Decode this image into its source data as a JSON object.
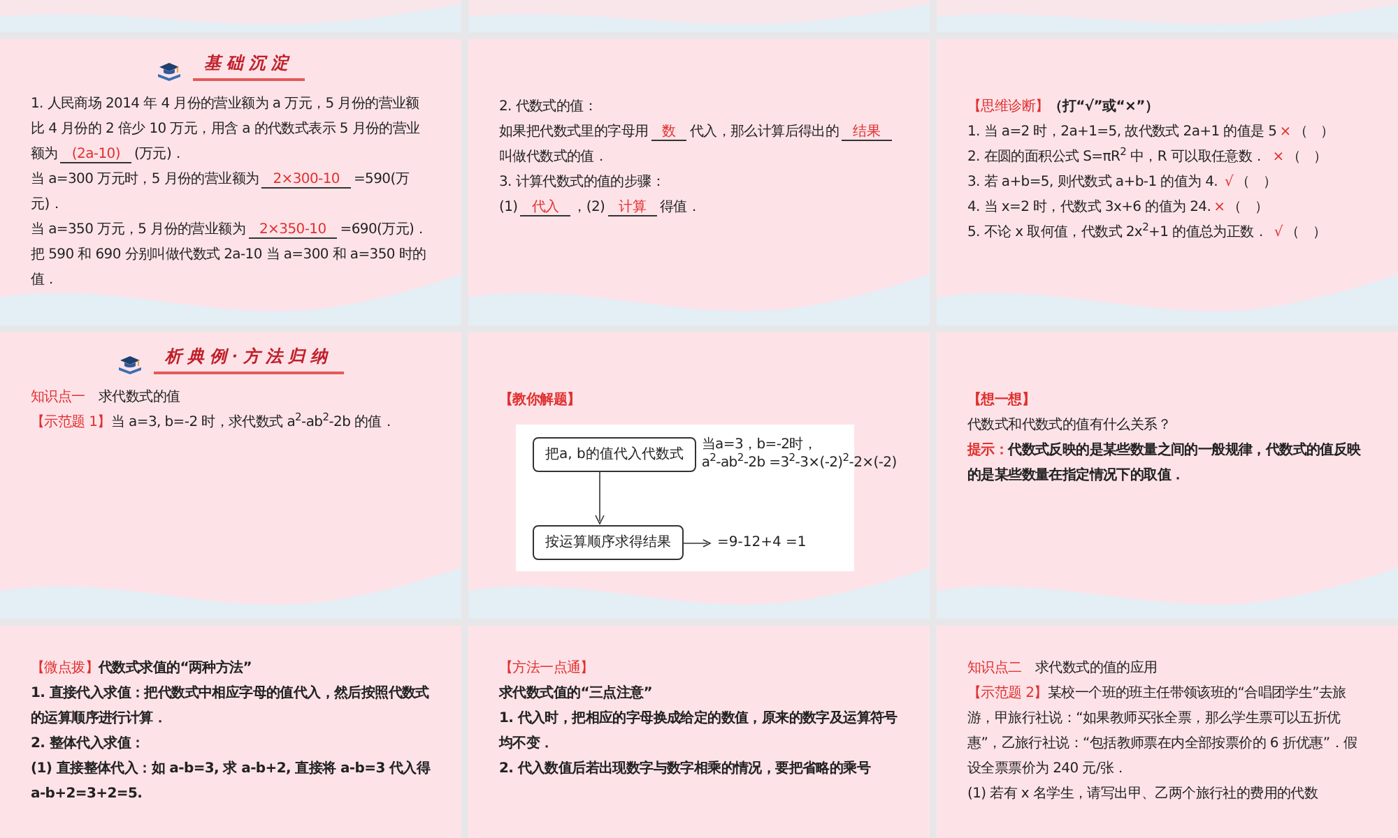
{
  "slides": [
    {
      "header": {
        "title": "基础沉淀"
      },
      "paragraphs": [
        [
          {
            "kind": "text",
            "text": "1. 人民商场 2014 年 4 月份的营业额为 a 万元，5 月份的营业额比 4 月份的 2 倍少 10 万元，用含 a 的代数式表示 5 月份的营业额为"
          },
          {
            "kind": "answer",
            "text": "(2a-10)"
          },
          {
            "kind": "text",
            "text": "(万元)．"
          }
        ],
        [
          {
            "kind": "text",
            "text": "当 a=300 万元时，5 月份的营业额为"
          },
          {
            "kind": "answer",
            "text": "2×300-10"
          },
          {
            "kind": "text",
            "text": "=590(万元)．"
          }
        ],
        [
          {
            "kind": "text",
            "text": "当 a=350 万元，5 月份的营业额为"
          },
          {
            "kind": "answer",
            "text": "2×350-10"
          },
          {
            "kind": "text",
            "text": "=690(万元)．"
          }
        ],
        [
          {
            "kind": "text",
            "text": "把 590 和 690 分别叫做代数式 2a-10 当 a=300 和 a=350 时的值．"
          }
        ]
      ]
    },
    {
      "paragraphs": [
        [
          {
            "kind": "text",
            "text": "2. 代数式的值："
          }
        ],
        [
          {
            "kind": "text",
            "text": "如果把代数式里的字母用"
          },
          {
            "kind": "answer",
            "text": "数"
          },
          {
            "kind": "text",
            "text": "代入，那么计算后得出的"
          },
          {
            "kind": "answer",
            "text": "结果"
          },
          {
            "kind": "text",
            "text": "叫做代数式的值．"
          }
        ],
        [
          {
            "kind": "text",
            "text": "3. 计算代数式的值的步骤："
          }
        ],
        [
          {
            "kind": "text",
            "text": "(1)"
          },
          {
            "kind": "answer",
            "text": "代入"
          },
          {
            "kind": "text",
            "text": "，(2)"
          },
          {
            "kind": "answer",
            "text": "计算"
          },
          {
            "kind": "text",
            "text": "得值．"
          }
        ]
      ]
    },
    {
      "paragraphs": [
        [
          {
            "kind": "label",
            "text": "【思维诊断】"
          },
          {
            "kind": "strong",
            "text": "（打“√”或“×”）"
          }
        ],
        [
          {
            "kind": "text",
            "text": "1. 当 a=2 时，2a+1=5, 故代数式 2a+1 的值是 5"
          },
          {
            "kind": "mark",
            "text": "×"
          },
          {
            "kind": "text",
            "text": "（　）"
          }
        ],
        [
          {
            "kind": "text",
            "text": "2. 在圆的面积公式 S=πR$^{2}$ 中，R 可以取任意数． "
          },
          {
            "kind": "mark",
            "text": "×"
          },
          {
            "kind": "text",
            "text": "（　）"
          }
        ],
        [
          {
            "kind": "text",
            "text": "3. 若 a+b=5, 则代数式 a+b-1 的值为 4. "
          },
          {
            "kind": "mark",
            "text": "√"
          },
          {
            "kind": "text",
            "text": "（　）"
          }
        ],
        [
          {
            "kind": "text",
            "text": "4. 当 x=2 时，代数式 3x+6 的值为 24."
          },
          {
            "kind": "mark",
            "text": "×"
          },
          {
            "kind": "text",
            "text": "（　）"
          }
        ],
        [
          {
            "kind": "text",
            "text": "5. 不论 x 取何值，代数式 2x$^{2}$+1 的值总为正数． "
          },
          {
            "kind": "mark",
            "text": "√"
          },
          {
            "kind": "text",
            "text": "（　）"
          }
        ]
      ]
    },
    {
      "header": {
        "title": "析典例·方法归纳"
      },
      "paragraphs": [
        [
          {
            "kind": "label",
            "text": "知识点一"
          },
          {
            "kind": "text",
            "text": "　求代数式的值"
          }
        ],
        [
          {
            "kind": "label",
            "text": "【示范题 1】"
          },
          {
            "kind": "text",
            "text": "当 a=3, b=-2 时，求代数式 a$^{2}$-ab$^{2}$-2b 的值．"
          }
        ]
      ]
    },
    {
      "paragraphs": [
        [
          {
            "kind": "strong-label",
            "text": "【教你解题】"
          }
        ]
      ],
      "flow": {
        "steps": [
          "把a, b的值代入代数式",
          "按运算顺序求得结果"
        ],
        "results": [
          [
            "当a=3，b=-2时，",
            "a$^{2}$-ab$^{2}$-2b =3$^{2}$-3×(-2)$^{2}$-2×(-2)"
          ],
          [
            "=9-12+4 =1"
          ]
        ]
      }
    },
    {
      "paragraphs": [
        [
          {
            "kind": "strong-label",
            "text": "【想一想】"
          }
        ],
        [
          {
            "kind": "text",
            "text": "代数式和代数式的值有什么关系？"
          }
        ],
        [
          {
            "kind": "strong-label",
            "text": "提示："
          },
          {
            "kind": "strong",
            "text": "代数式反映的是某些数量之间的一般规律，代数式的值反映的是某些数量在指定情况下的取值．"
          }
        ]
      ]
    },
    {
      "paragraphs": [
        [
          {
            "kind": "label",
            "text": "【微点拨】"
          },
          {
            "kind": "strong",
            "text": "代数式求值的“两种方法”"
          }
        ],
        [
          {
            "kind": "strong",
            "text": "1. 直接代入求值：把代数式中相应字母的值代入，然后按照代数式的运算顺序进行计算．"
          }
        ],
        [
          {
            "kind": "strong",
            "text": "2. 整体代入求值："
          }
        ],
        [
          {
            "kind": "strong",
            "text": "(1) 直接整体代入：如 a-b=3, 求 a-b+2, 直接将 a-b=3 代入得 a-b+2=3+2=5."
          }
        ]
      ]
    },
    {
      "paragraphs": [
        [
          {
            "kind": "label",
            "text": "【方法一点通】"
          }
        ],
        [
          {
            "kind": "strong",
            "text": "求代数式值的“三点注意”"
          }
        ],
        [
          {
            "kind": "strong",
            "text": "1. 代入时，把相应的字母换成给定的数值，原来的数字及运算符号均不变．"
          }
        ],
        [
          {
            "kind": "strong",
            "text": "2. 代入数值后若出现数字与数字相乘的情况，要把省略的乘号"
          }
        ]
      ]
    },
    {
      "paragraphs": [
        [
          {
            "kind": "label",
            "text": "知识点二"
          },
          {
            "kind": "text",
            "text": "　求代数式的值的应用"
          }
        ],
        [
          {
            "kind": "label",
            "text": "【示范题 2】"
          },
          {
            "kind": "text",
            "text": "某校一个班的班主任带领该班的“合唱团学生”去旅游，甲旅行社说：“如果教师买张全票，那么学生票可以五折优惠”，乙旅行社说：“包括教师票在内全部按票价的 6 折优惠”．假设全票票价为 240 元/张．"
          }
        ],
        [
          {
            "kind": "text",
            "text": "(1) 若有 x 名学生，请写出甲、乙两个旅行社的费用的代数"
          }
        ]
      ]
    }
  ]
}
